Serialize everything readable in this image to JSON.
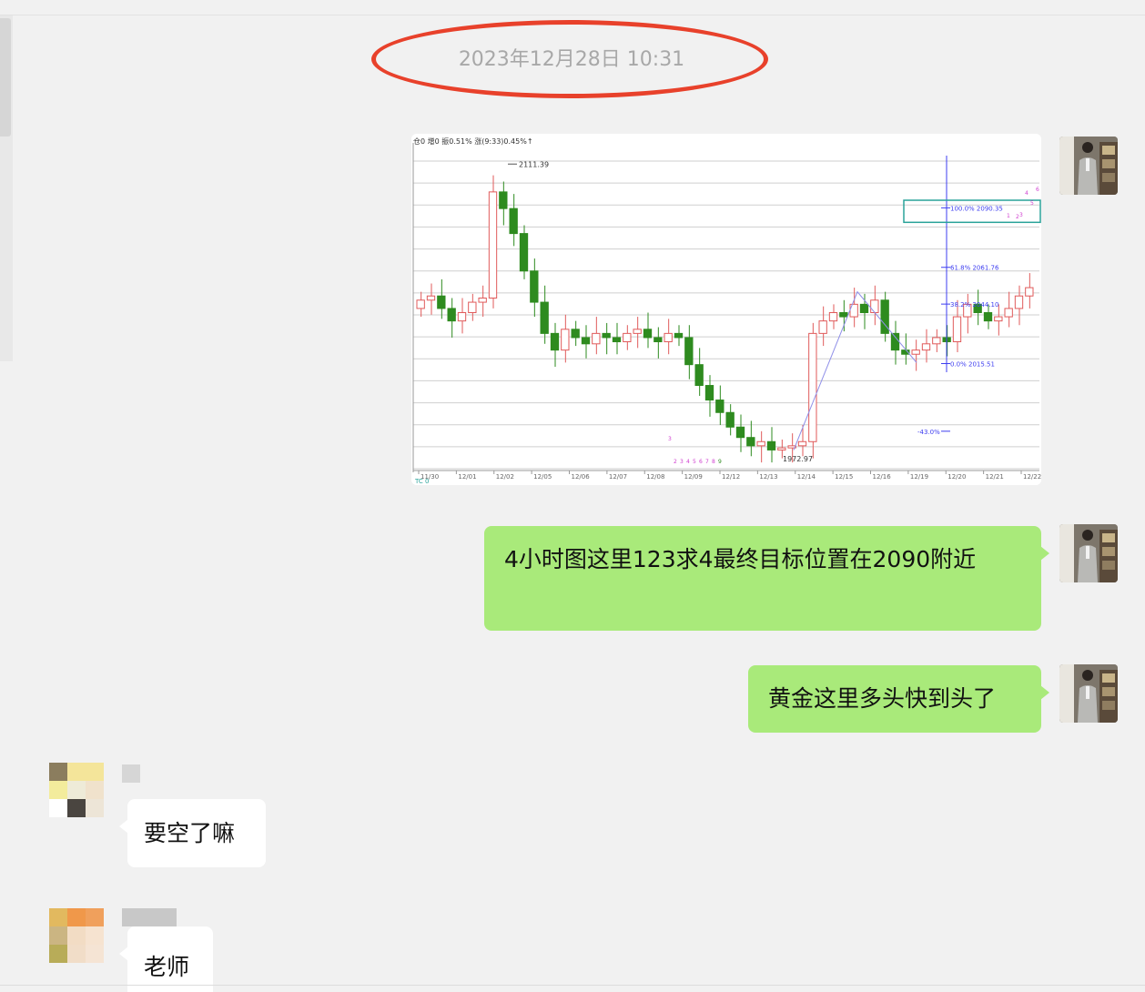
{
  "timestamp": "2023年12月28日 10:31",
  "messages": [
    {
      "side": "right",
      "type": "image",
      "content": "chart-screenshot"
    },
    {
      "side": "right",
      "type": "text",
      "text": "4小时图这里123求4最终目标位置在2090附近"
    },
    {
      "side": "right",
      "type": "text",
      "text": "黄金这里多头快到头了"
    },
    {
      "side": "left",
      "type": "text",
      "text": "要空了嘛"
    },
    {
      "side": "left",
      "type": "text",
      "text": "老师"
    }
  ],
  "chart": {
    "header": "仓0 增0 振0.51% 涨(9:33)0.45%↑",
    "footer": "TC 0",
    "high_label": "2111.39",
    "low_label": "1972.97",
    "fib_levels": [
      {
        "label": "100.0% 2090.35",
        "value": 2090.35
      },
      {
        "label": "61.8% 2061.76",
        "value": 2061.76
      },
      {
        "label": "38.2% 2044.10",
        "value": 2044.1
      },
      {
        "label": "0.0% 2015.51",
        "value": 2015.51
      },
      {
        "label": "-43.0%",
        "value": 1983.0
      }
    ],
    "wave_labels_bottom": [
      "2",
      "3",
      "4",
      "5",
      "6",
      "7",
      "8",
      "9"
    ],
    "wave_label_mid": "3",
    "wave_labels_top": [
      "1",
      "2",
      "3",
      "4",
      "5",
      "6"
    ],
    "date_labels": [
      "11/30",
      "12/01",
      "12/02",
      "12/05",
      "12/06",
      "12/07",
      "12/08",
      "12/09",
      "12/12",
      "12/13",
      "12/14",
      "12/15",
      "12/16",
      "12/19",
      "12/20",
      "12/21",
      "12/22"
    ]
  },
  "colors": {
    "bubble_self": "#a9ea7a",
    "bubble_other": "#ffffff",
    "highlight_ellipse": "#e8412b",
    "candle_up": "#e05a5a",
    "candle_down": "#2e8b1f",
    "fib_line": "#3d3df0",
    "target_box": "#2aa39a"
  }
}
